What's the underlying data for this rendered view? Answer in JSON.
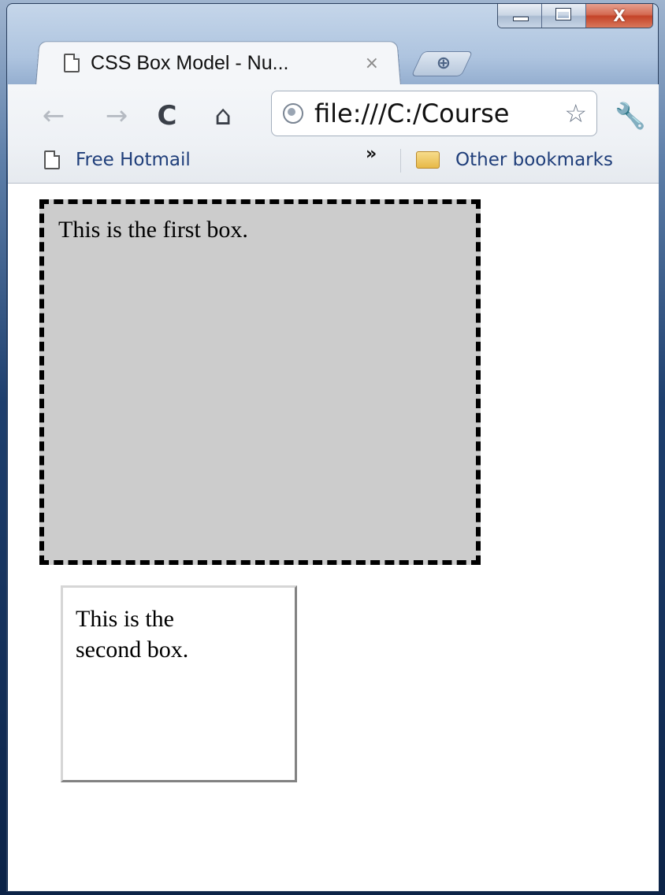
{
  "window": {
    "minimize_icon": "minimize-icon",
    "maximize_icon": "maximize-icon",
    "close_glyph": "X"
  },
  "tab": {
    "title": "CSS Box Model - Nu...",
    "close_glyph": "×",
    "new_tab_glyph": "⊕"
  },
  "toolbar": {
    "back_glyph": "←",
    "forward_glyph": "→",
    "reload_glyph": "C",
    "home_glyph": "⌂",
    "url": "file:///C:/Course",
    "star_glyph": "☆",
    "wrench_glyph": "🔧"
  },
  "bookmarks": {
    "items": [
      {
        "label": "Free Hotmail",
        "icon": "page-icon"
      },
      {
        "label": "Other bookmarks",
        "icon": "folder-icon"
      }
    ],
    "overflow_glyph": "»"
  },
  "content": {
    "box1_text": "This is the first box.",
    "box2_text": "This is the second box."
  },
  "colors": {
    "box1_background": "#cccccc",
    "box1_border": "#000000",
    "page_background": "#ffffff"
  }
}
